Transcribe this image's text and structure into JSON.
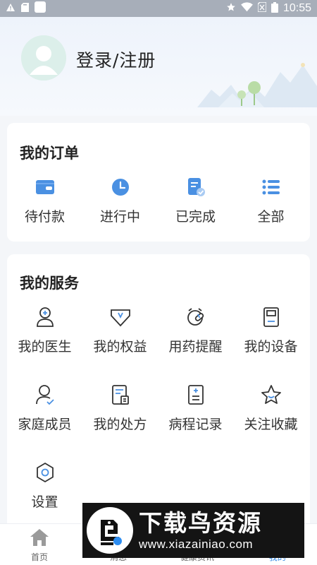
{
  "status_bar": {
    "time": "10:55",
    "icons": [
      "warning-icon",
      "sd-card-icon",
      "app-square-icon",
      "star-icon",
      "wifi-icon",
      "no-sim-icon",
      "battery-icon"
    ]
  },
  "header": {
    "login_text": "登录/注册"
  },
  "orders": {
    "title": "我的订单",
    "items": [
      {
        "label": "待付款",
        "icon": "wallet-icon"
      },
      {
        "label": "进行中",
        "icon": "clock-icon"
      },
      {
        "label": "已完成",
        "icon": "completed-doc-icon"
      },
      {
        "label": "全部",
        "icon": "list-icon"
      }
    ]
  },
  "services": {
    "title": "我的服务",
    "items": [
      {
        "label": "我的医生",
        "icon": "doctor-icon"
      },
      {
        "label": "我的权益",
        "icon": "rights-badge-icon"
      },
      {
        "label": "用药提醒",
        "icon": "alarm-pill-icon"
      },
      {
        "label": "我的设备",
        "icon": "device-icon"
      },
      {
        "label": "家庭成员",
        "icon": "family-member-icon"
      },
      {
        "label": "我的处方",
        "icon": "prescription-icon"
      },
      {
        "label": "病程记录",
        "icon": "medical-record-icon"
      },
      {
        "label": "关注收藏",
        "icon": "star-outline-icon"
      },
      {
        "label": "设置",
        "icon": "settings-gear-icon"
      }
    ]
  },
  "tabbar": {
    "tabs": [
      {
        "label": "首页",
        "icon": "home-icon"
      },
      {
        "label": "消息",
        "icon": "message-icon"
      },
      {
        "label": "健康资讯",
        "icon": "news-icon"
      },
      {
        "label": "我的",
        "icon": "profile-icon",
        "active": true
      }
    ]
  },
  "watermark": {
    "title": "下载鸟资源",
    "url": "www.xiazainiao.com"
  },
  "colors": {
    "accent": "#3a8ee6",
    "icon_blue": "#4a90e2",
    "card_bg": "#ffffff",
    "page_bg": "#f4f6f9"
  }
}
